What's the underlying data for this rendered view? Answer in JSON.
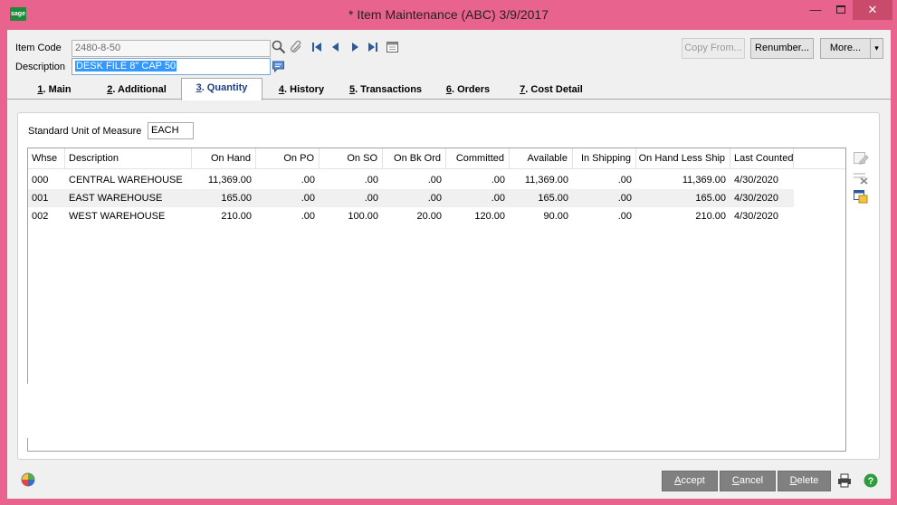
{
  "window": {
    "title": "* Item Maintenance (ABC) 3/9/2017",
    "logo_text": "sage",
    "minimize": "—",
    "close": "✕"
  },
  "header": {
    "item_code_label": "Item Code",
    "item_code_value": "2480-8-50",
    "description_label": "Description",
    "description_value": "DESK FILE 8\" CAP 50"
  },
  "toolbar": {
    "copy_from": "Copy From...",
    "renumber": "Renumber...",
    "more": "More...",
    "more_arrow": "▾"
  },
  "tabs": [
    {
      "key": "1",
      "label": ". Main"
    },
    {
      "key": "2",
      "label": ". Additional"
    },
    {
      "key": "3",
      "label": ". Quantity"
    },
    {
      "key": "4",
      "label": ". History"
    },
    {
      "key": "5",
      "label": ". Transactions"
    },
    {
      "key": "6",
      "label": ". Orders"
    },
    {
      "key": "7",
      "label": ". Cost Detail"
    }
  ],
  "quantity": {
    "uom_label": "Standard Unit of Measure",
    "uom_value": "EACH",
    "columns": [
      "Whse",
      "Description",
      "On Hand",
      "On PO",
      "On SO",
      "On Bk Ord",
      "Committed",
      "Available",
      "In Shipping",
      "On Hand Less Ship",
      "Last Counted"
    ],
    "rows": [
      [
        "000",
        "CENTRAL WAREHOUSE",
        "11,369.00",
        ".00",
        ".00",
        ".00",
        ".00",
        "11,369.00",
        ".00",
        "11,369.00",
        "4/30/2020"
      ],
      [
        "001",
        "EAST WAREHOUSE",
        "165.00",
        ".00",
        ".00",
        ".00",
        ".00",
        "165.00",
        ".00",
        "165.00",
        "4/30/2020"
      ],
      [
        "002",
        "WEST WAREHOUSE",
        "210.00",
        ".00",
        "100.00",
        "20.00",
        "120.00",
        "90.00",
        ".00",
        "210.00",
        "4/30/2020"
      ]
    ]
  },
  "footer": {
    "accept_key": "A",
    "accept_rest": "ccept",
    "cancel_key": "C",
    "cancel_rest": "ancel",
    "delete_key": "D",
    "delete_rest": "elete"
  },
  "colors": {
    "frame": "#e8648f",
    "client": "#f0f0f0",
    "active_tab_text": "#1f3f86"
  },
  "icons": [
    "search-icon",
    "attach-icon",
    "first-record-icon",
    "previous-record-icon",
    "next-record-icon",
    "last-record-icon",
    "calendar-icon",
    "memo-icon",
    "edit-row-icon",
    "delete-row-icon",
    "lot-serial-icon",
    "sage-ball-icon",
    "printer-icon",
    "help-icon"
  ]
}
